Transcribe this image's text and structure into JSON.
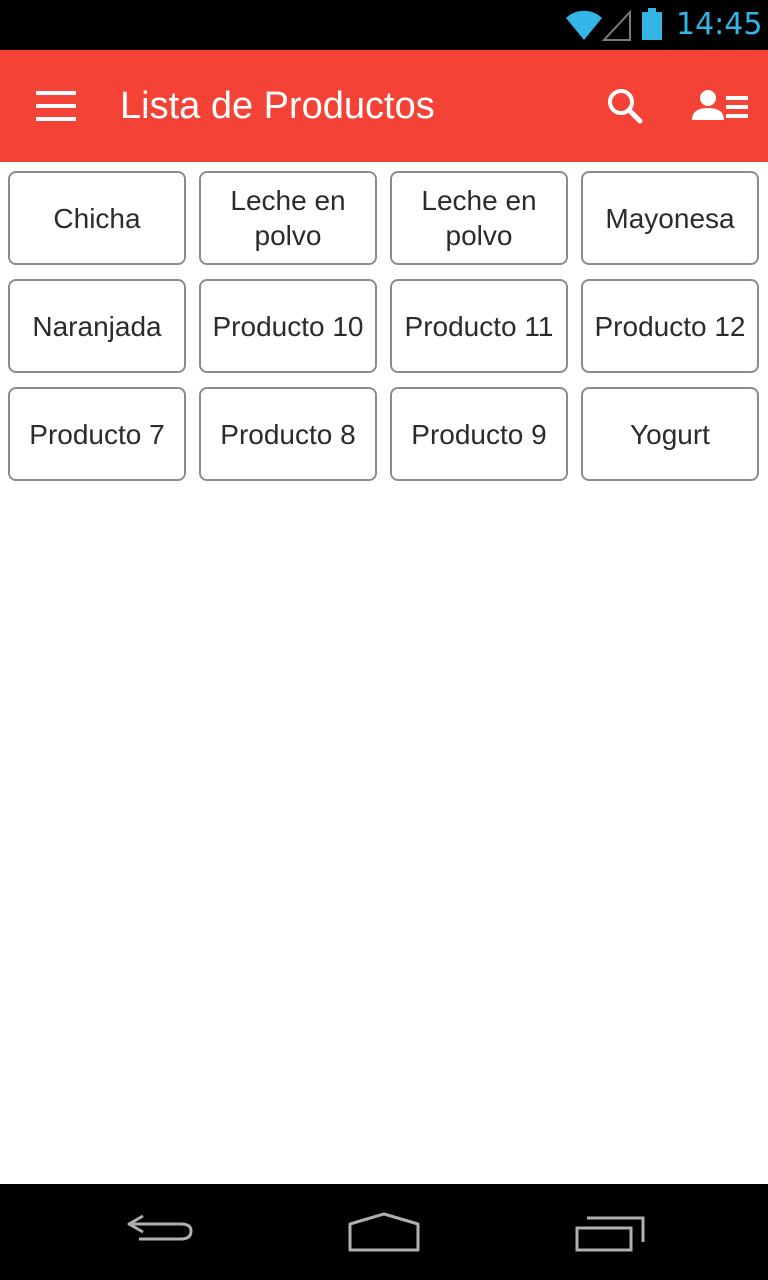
{
  "status_bar": {
    "time": "14:45",
    "icons": [
      "wifi-icon",
      "cell-signal-icon",
      "battery-icon"
    ],
    "accent_color": "#33b5e5"
  },
  "app_bar": {
    "title": "Lista de Productos",
    "background_color": "#f44336",
    "icons": [
      "hamburger-menu-icon",
      "search-icon",
      "user-list-icon"
    ]
  },
  "products": [
    {
      "label": "Chicha"
    },
    {
      "label": "Leche en polvo"
    },
    {
      "label": "Leche en polvo"
    },
    {
      "label": "Mayonesa"
    },
    {
      "label": "Naranjada"
    },
    {
      "label": "Producto 10"
    },
    {
      "label": "Producto 11"
    },
    {
      "label": "Producto 12"
    },
    {
      "label": "Producto 7"
    },
    {
      "label": "Producto 8"
    },
    {
      "label": "Producto 9"
    },
    {
      "label": "Yogurt"
    }
  ],
  "nav_bar": {
    "icons": [
      "back-icon",
      "home-icon",
      "recent-apps-icon"
    ]
  }
}
